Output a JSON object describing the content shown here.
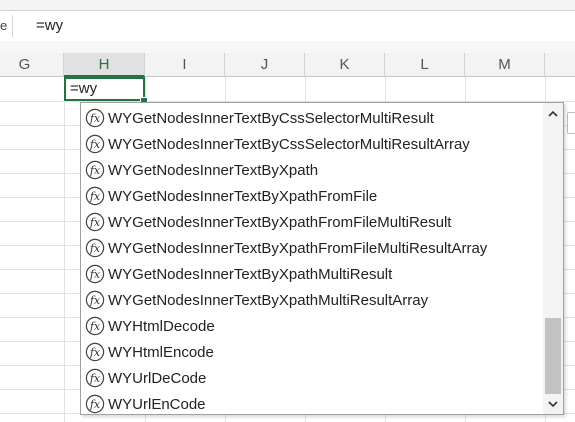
{
  "formula_bar": {
    "name_box_stub": "e",
    "content": "=wy"
  },
  "columns": [
    "G",
    "H",
    "I",
    "J",
    "K",
    "L",
    "M"
  ],
  "active_column": "H",
  "active_cell": {
    "value": "=wy"
  },
  "autocomplete": {
    "icon": "function-fx-icon",
    "items": [
      "WYGetNodesInnerTextByCssSelectorMultiResult",
      "WYGetNodesInnerTextByCssSelectorMultiResultArray",
      "WYGetNodesInnerTextByXpath",
      "WYGetNodesInnerTextByXpathFromFile",
      "WYGetNodesInnerTextByXpathFromFileMultiResult",
      "WYGetNodesInnerTextByXpathFromFileMultiResultArray",
      "WYGetNodesInnerTextByXpathMultiResult",
      "WYGetNodesInnerTextByXpathMultiResultArray",
      "WYHtmlDecode",
      "WYHtmlEncode",
      "WYUrlDeCode",
      "WYUrlEnCode"
    ]
  },
  "colors": {
    "accent": "#217346",
    "header_bg": "#f3f3f3",
    "gridline": "#e1e1e1",
    "scroll_thumb": "#c2c2c2"
  }
}
